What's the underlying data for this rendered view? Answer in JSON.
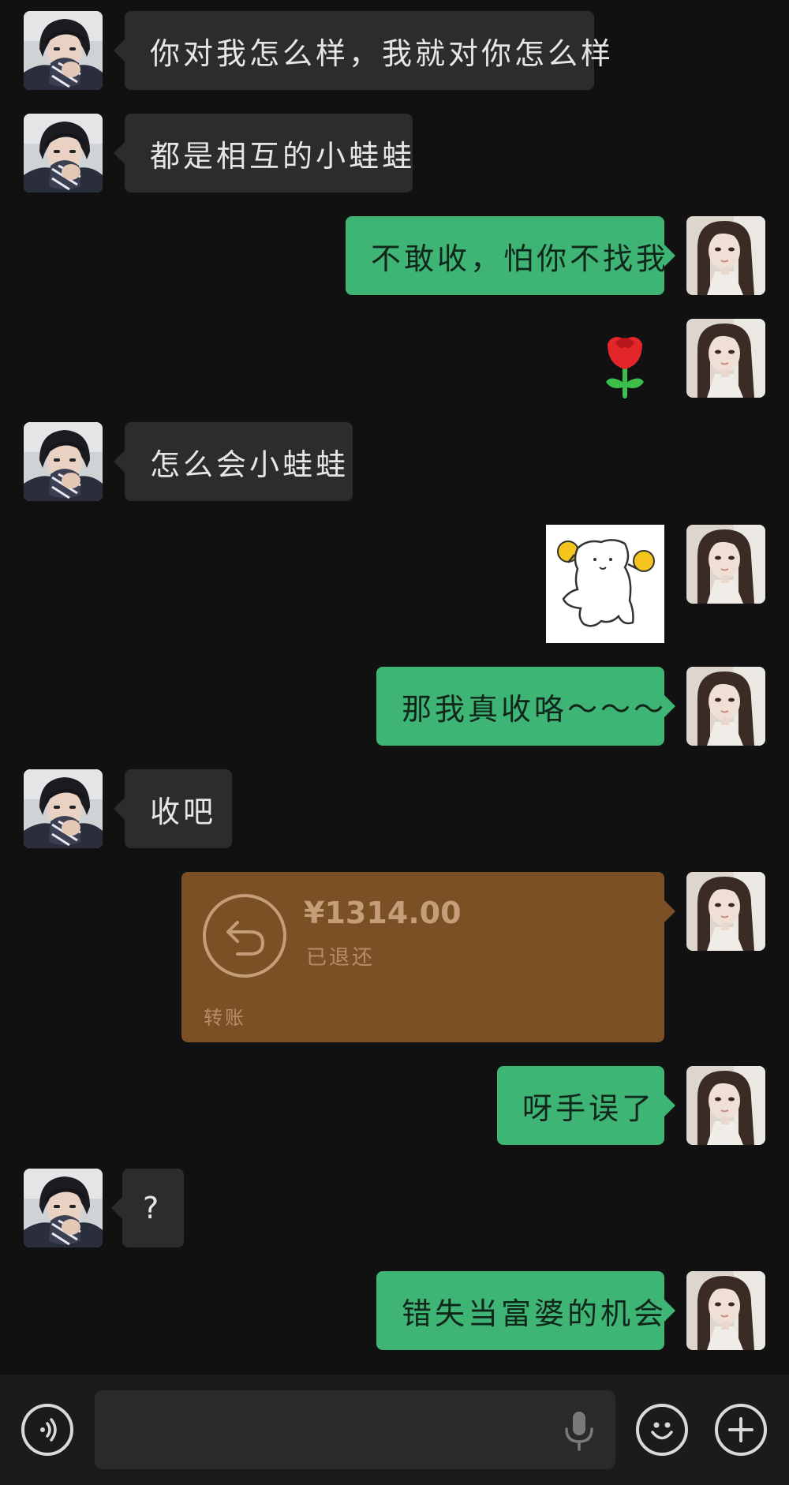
{
  "messages": [
    {
      "side": "left",
      "text": "你对我怎么样，我就对你怎么样"
    },
    {
      "side": "left",
      "text": "都是相互的小蛙蛙"
    },
    {
      "side": "right",
      "text": "不敢收，怕你不找我"
    },
    {
      "side": "right",
      "sticker": "rose-emoji"
    },
    {
      "side": "left",
      "text": "怎么会小蛙蛙"
    },
    {
      "side": "right",
      "sticker": "cat-holding-coins-sticker"
    },
    {
      "side": "right",
      "text": "那我真收咯～～～"
    },
    {
      "side": "left",
      "text": "收吧"
    },
    {
      "side": "right",
      "transfer": {
        "amount": "¥1314.00",
        "status": "已退还",
        "label": "转账"
      }
    },
    {
      "side": "right",
      "text": "呀手误了"
    },
    {
      "side": "left",
      "text": "?"
    },
    {
      "side": "right",
      "text": "错失当富婆的机会"
    }
  ],
  "colors": {
    "background": "#111111",
    "left_bubble": "#2c2c2c",
    "right_bubble": "#3eb575",
    "transfer_card": "#7b5024",
    "input_bar": "#1b1b1b"
  },
  "input_bar": {
    "voice_icon": "voice-toggle-icon",
    "mic_icon": "microphone-icon",
    "emoji_icon": "emoji-icon",
    "plus_icon": "plus-icon",
    "value": ""
  }
}
